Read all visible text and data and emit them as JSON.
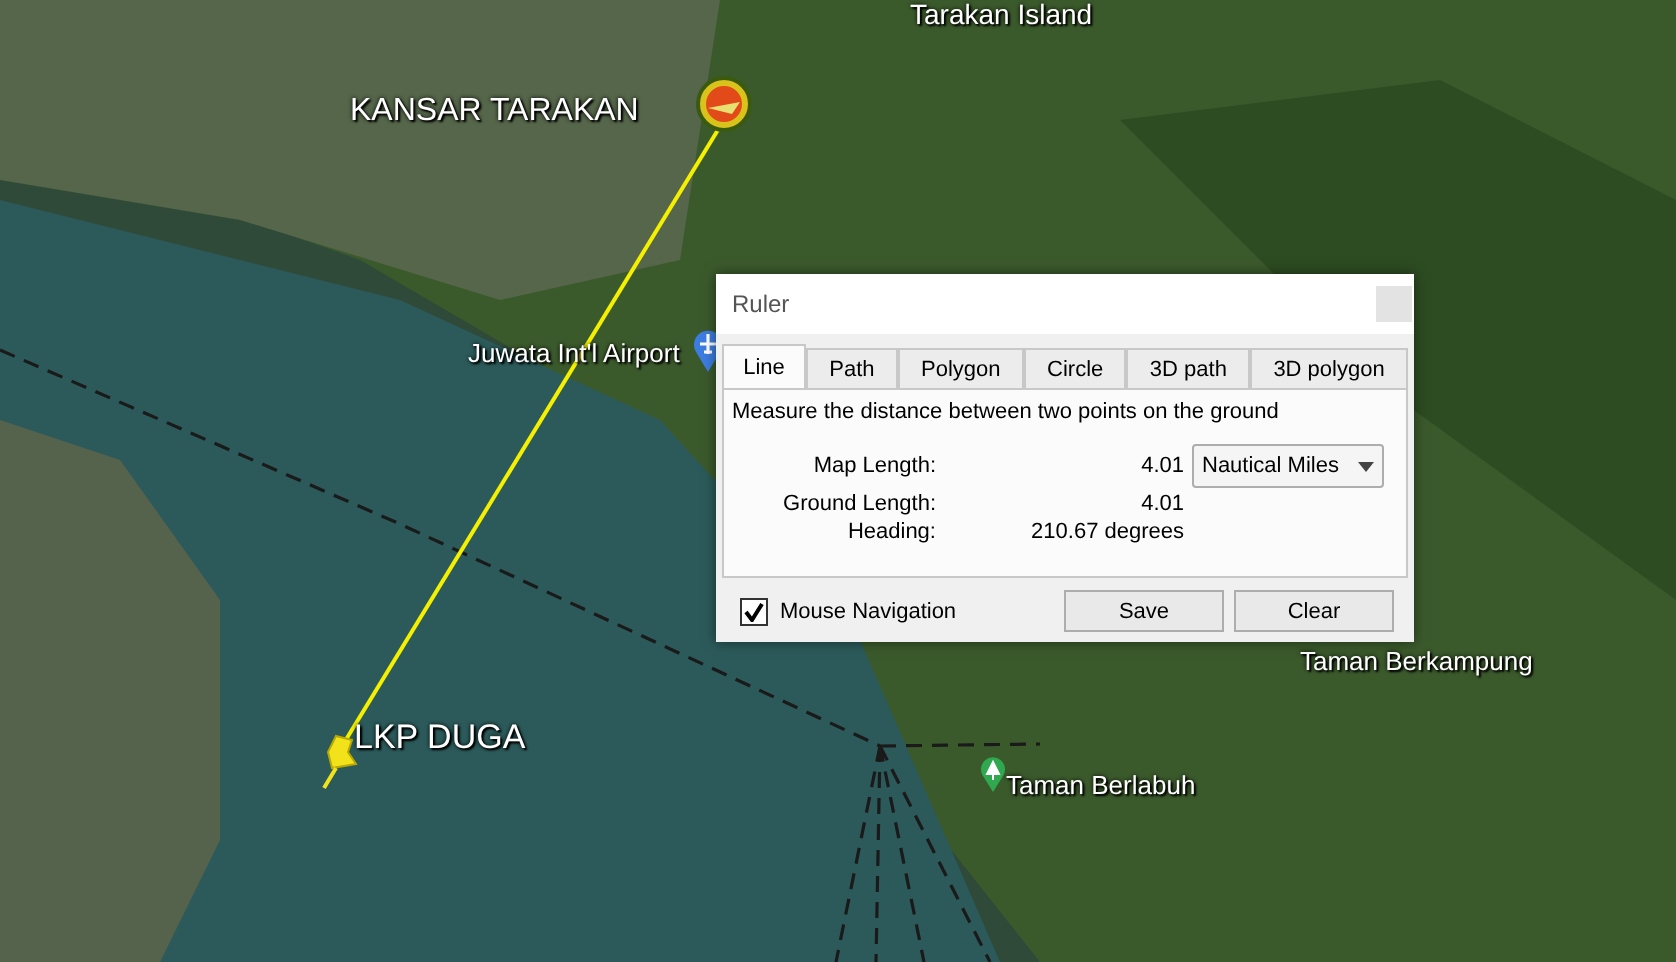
{
  "map": {
    "labels": [
      {
        "text": "Tarakan Island",
        "kind": "plain"
      },
      {
        "text": "KANSAR TARAKAN",
        "kind": "placemark"
      },
      {
        "text": "Juwata Int'l Airport",
        "kind": "airport"
      },
      {
        "text": "LKP DUGA",
        "kind": "pushpin"
      },
      {
        "text": "Taman Berlabuh",
        "kind": "park"
      },
      {
        "text": "Taman Berkampung",
        "kind": "plain"
      }
    ]
  },
  "ruler": {
    "title": "Ruler",
    "tabs": [
      {
        "label": "Line",
        "selected": true
      },
      {
        "label": "Path",
        "selected": false
      },
      {
        "label": "Polygon",
        "selected": false
      },
      {
        "label": "Circle",
        "selected": false
      },
      {
        "label": "3D path",
        "selected": false
      },
      {
        "label": "3D polygon",
        "selected": false
      }
    ],
    "description": "Measure the distance between two points on the ground",
    "rows": [
      {
        "label": "Map Length:",
        "value": "4.01",
        "unit_dropdown": "Nautical Miles"
      },
      {
        "label": "Ground Length:",
        "value": "4.01"
      },
      {
        "label": "Heading:",
        "value": "210.67 degrees"
      }
    ],
    "mouse_navigation": {
      "label": "Mouse Navigation",
      "checked": true
    },
    "buttons": [
      "Save",
      "Clear"
    ]
  }
}
